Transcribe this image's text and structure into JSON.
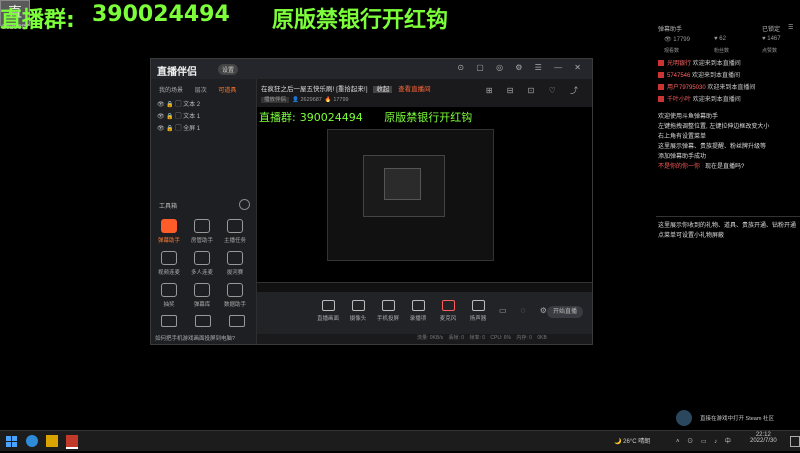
{
  "overlay": {
    "group_label": "直播群:",
    "group_number": "390024494",
    "promo": "原版禁银行开红钩",
    "small_id": "2629687",
    "logo_char": "直"
  },
  "app": {
    "brand": "直播伴侣",
    "brand_badge": "设置",
    "tabs": [
      "我的场景",
      "层次",
      "可道具"
    ],
    "active_tab_index": 2,
    "layers": [
      "文本 2",
      "文本 1",
      "全屏 1"
    ],
    "tools_title": "工具箱",
    "tools": [
      {
        "label": "弹幕助手",
        "hot": true,
        "icon": "danmu-icon"
      },
      {
        "label": "房管助手",
        "hot": false,
        "icon": "user-icon"
      },
      {
        "label": "主播任务",
        "hot": false,
        "icon": "task-icon"
      },
      {
        "label": "视频连麦",
        "hot": false,
        "icon": "video-call-icon"
      },
      {
        "label": "多人连麦",
        "hot": false,
        "icon": "group-icon"
      },
      {
        "label": "拔河赛",
        "hot": false,
        "icon": "game-icon"
      },
      {
        "label": "抽奖",
        "hot": false,
        "icon": "gift-icon"
      },
      {
        "label": "弹幕库",
        "hot": false,
        "icon": "list-icon"
      },
      {
        "label": "数据助手",
        "hot": false,
        "icon": "chart-icon"
      }
    ],
    "hint": "如何把手机游戏画面投屏到电脑?",
    "room_title": "在疯狂之后一屋五快乐刷! [重拾起来!]",
    "room_tag": "收起",
    "room_extra": "查看直播间",
    "room_meta_user": "播放伴侣",
    "room_meta_count": "2629687",
    "room_meta_likes": "17799",
    "inner_overlay_number": "390024494",
    "inner_overlay_promo": "原版禁银行开红钩",
    "bottom_buttons": [
      "直播画面",
      "摄像头",
      "手机投屏",
      "录播项",
      "麦克风",
      "扬声器"
    ],
    "start_label": "开始直播",
    "status": [
      "流量: 0KB/s",
      "丢帧: 0",
      "帧率: 0",
      "CPU: 6%",
      "内存: 0",
      "0KB"
    ]
  },
  "right_panel": {
    "header": "弹幕助手",
    "header_right": "已锁定",
    "stats": [
      "17799",
      "62",
      "1467"
    ],
    "stat_labels": [
      "观看数",
      "粉丝数",
      "点赞数"
    ],
    "chat": [
      {
        "user": "光明银行",
        "msg": "欢迎来到本直播间"
      },
      {
        "user": "5747546",
        "msg": "欢迎来到本直播间"
      },
      {
        "user": "用户79795030",
        "msg": "欢迎来到本直播间"
      },
      {
        "user": "千叶小叶",
        "msg": "欢迎来到本直播间"
      }
    ],
    "help_lines": [
      "欢迎使用斗鱼弹幕助手",
      "左键拖拽调整位置, 左键拉伸边框改变大小",
      "右上角有设置菜单",
      "这里展示弹幕、贵族提醒、粉丝牌升级等",
      "添加弹幕助手成功",
      "现在是直播吗?"
    ],
    "help_red": "不是你的你一你",
    "help2_lines": [
      "这里展示你收到的礼物、道具、贵族开通、钻粉开通",
      "点菜单可设置小礼物屏蔽"
    ]
  },
  "taskbar": {
    "weather": "26°C 晴朗",
    "time": "22:12",
    "date": "2022/7/30",
    "toast": "直接在游戏中打开 Steam 社区",
    "tray_app": "Steam"
  }
}
